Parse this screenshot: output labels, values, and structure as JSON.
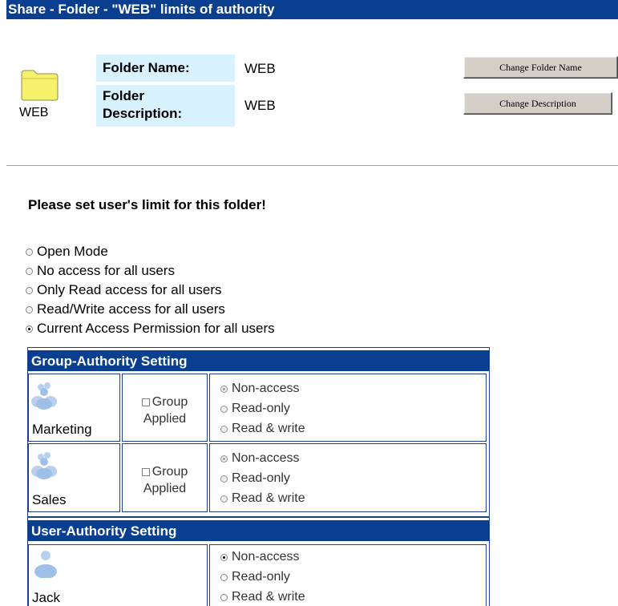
{
  "title": "Share - Folder - \"WEB\" limits of authority",
  "folder": {
    "icon": "folder-icon",
    "caption": "WEB",
    "name_label": "Folder Name:",
    "name_value": "WEB",
    "desc_label_1": "Folder",
    "desc_label_2": "Description:",
    "desc_value": "WEB"
  },
  "buttons": {
    "change_name": "Change Folder Name",
    "change_description": "Change Description"
  },
  "heading": "Please set user's limit for this folder!",
  "modes": [
    {
      "label": "Open Mode",
      "selected": false
    },
    {
      "label": "No access for all users",
      "selected": false
    },
    {
      "label": "Only Read access for all users",
      "selected": false
    },
    {
      "label": "Read/Write access for all users",
      "selected": false
    },
    {
      "label": "Current Access Permission for all users",
      "selected": true
    }
  ],
  "group_section": {
    "title": "Group-Authority Setting",
    "groups": [
      {
        "name": "Marketing",
        "icon": "group-icon",
        "applied_1": "Group",
        "applied_2": "Applied",
        "options": [
          "Non-access",
          "Read-only",
          "Read & write"
        ],
        "selected": "Non-access"
      },
      {
        "name": "Sales",
        "icon": "group-icon",
        "applied_1": "Group",
        "applied_2": "Applied",
        "options": [
          "Non-access",
          "Read-only",
          "Read & write"
        ],
        "selected": "Non-access"
      }
    ]
  },
  "user_section": {
    "title": "User-Authority Setting",
    "users": [
      {
        "name": "Jack",
        "icon": "user-icon",
        "options": [
          "Non-access",
          "Read-only",
          "Read & write"
        ],
        "selected": "Non-access"
      }
    ]
  },
  "colors": {
    "header_bg": "#0a3f8f",
    "label_bg": "#d9f2ff",
    "border": "#1c3f90"
  }
}
